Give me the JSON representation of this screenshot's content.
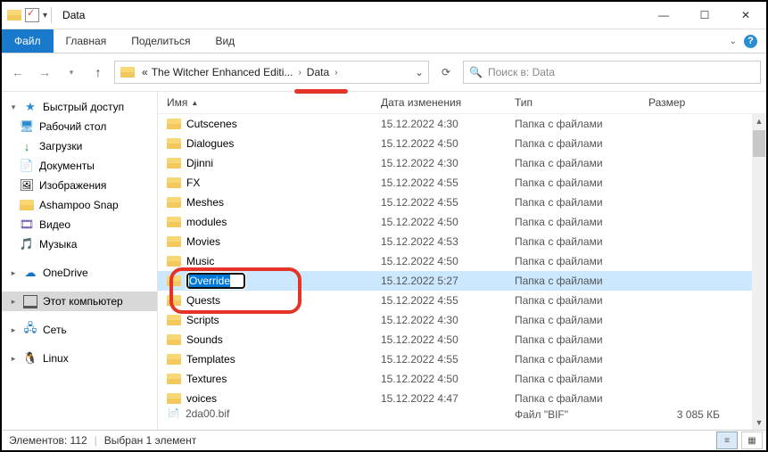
{
  "window": {
    "title": "Data"
  },
  "ribbon": {
    "file": "Файл",
    "tabs": [
      "Главная",
      "Поделиться",
      "Вид"
    ]
  },
  "nav": {
    "back_sep": "«",
    "crumb1": "The Witcher Enhanced Editi...",
    "crumb2": "Data"
  },
  "search": {
    "placeholder": "Поиск в: Data"
  },
  "columns": {
    "name": "Имя",
    "date": "Дата изменения",
    "type": "Тип",
    "size": "Размер"
  },
  "side": {
    "quick": "Быстрый доступ",
    "desktop": "Рабочий стол",
    "downloads": "Загрузки",
    "documents": "Документы",
    "pictures": "Изображения",
    "ashampoo": "Ashampoo Snap",
    "video": "Видео",
    "music": "Музыка",
    "onedrive": "OneDrive",
    "thispc": "Этот компьютер",
    "network": "Сеть",
    "linux": "Linux"
  },
  "rows": [
    {
      "name": "Cutscenes",
      "date": "15.12.2022 4:30",
      "type": "Папка с файлами"
    },
    {
      "name": "Dialogues",
      "date": "15.12.2022 4:50",
      "type": "Папка с файлами"
    },
    {
      "name": "Djinni",
      "date": "15.12.2022 4:30",
      "type": "Папка с файлами"
    },
    {
      "name": "FX",
      "date": "15.12.2022 4:55",
      "type": "Папка с файлами"
    },
    {
      "name": "Meshes",
      "date": "15.12.2022 4:55",
      "type": "Папка с файлами"
    },
    {
      "name": "modules",
      "date": "15.12.2022 4:50",
      "type": "Папка с файлами"
    },
    {
      "name": "Movies",
      "date": "15.12.2022 4:53",
      "type": "Папка с файлами"
    },
    {
      "name": "Music",
      "date": "15.12.2022 4:50",
      "type": "Папка с файлами"
    },
    {
      "name": "Override",
      "date": "15.12.2022 5:27",
      "type": "Папка с файлами",
      "selected": true,
      "editing": true
    },
    {
      "name": "Quests",
      "date": "15.12.2022 4:55",
      "type": "Папка с файлами"
    },
    {
      "name": "Scripts",
      "date": "15.12.2022 4:30",
      "type": "Папка с файлами"
    },
    {
      "name": "Sounds",
      "date": "15.12.2022 4:50",
      "type": "Папка с файлами"
    },
    {
      "name": "Templates",
      "date": "15.12.2022 4:55",
      "type": "Папка с файлами"
    },
    {
      "name": "Textures",
      "date": "15.12.2022 4:50",
      "type": "Папка с файлами"
    },
    {
      "name": "voices",
      "date": "15.12.2022 4:47",
      "type": "Папка с файлами"
    }
  ],
  "cutoff": {
    "name": "2da00.bif",
    "date": "",
    "type": "Файл \"BIF\"",
    "size": "3 085 КБ"
  },
  "status": {
    "count": "Элементов: 112",
    "selected": "Выбран 1 элемент"
  }
}
